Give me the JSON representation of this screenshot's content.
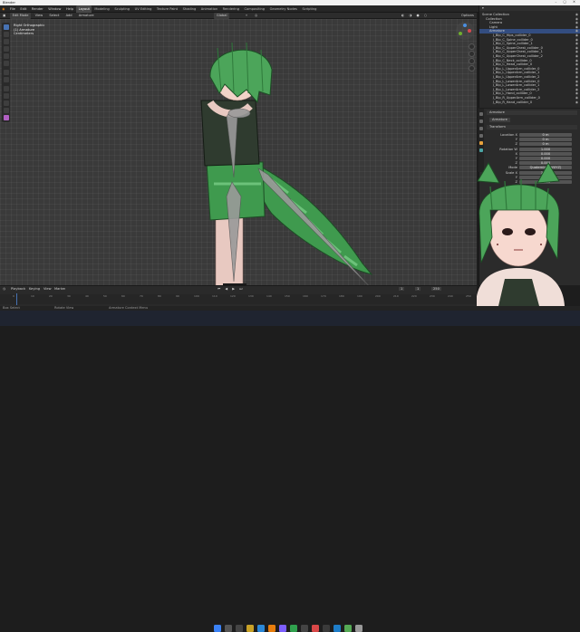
{
  "window": {
    "title": "Blender"
  },
  "menu": {
    "items": [
      "File",
      "Edit",
      "Render",
      "Window",
      "Help"
    ],
    "workspaces": [
      "Layout",
      "Modeling",
      "Sculpting",
      "UV Editing",
      "Texture Paint",
      "Shading",
      "Animation",
      "Rendering",
      "Compositing",
      "Geometry Nodes",
      "Scripting"
    ],
    "active_workspace": "Layout",
    "scene": "Scene",
    "view_layer": "ViewLayer"
  },
  "header": {
    "mode": "Edit Mode",
    "items": [
      "View",
      "Select",
      "Add",
      "Armature"
    ],
    "transform_orientation": "Global",
    "options": "Options"
  },
  "viewport": {
    "info_lines": [
      "Right Orthographic",
      "(1) Armature",
      "Centimeters"
    ],
    "overlay_label": "Options"
  },
  "outliner": {
    "title": "Scene Collection",
    "rows": [
      {
        "label": "Scene Collection",
        "indent": 0
      },
      {
        "label": "Collection",
        "indent": 1
      },
      {
        "label": "Camera",
        "indent": 2
      },
      {
        "label": "Light",
        "indent": 2
      },
      {
        "label": "Armature",
        "indent": 2
      },
      {
        "label": "J_Bip_C_Hips_collider_0",
        "indent": 3
      },
      {
        "label": "J_Bip_C_Spine_collider_0",
        "indent": 3
      },
      {
        "label": "J_Bip_C_Spine_collider_1",
        "indent": 3
      },
      {
        "label": "J_Bip_C_UpperChest_collider_0",
        "indent": 3
      },
      {
        "label": "J_Bip_C_UpperChest_collider_1",
        "indent": 3
      },
      {
        "label": "J_Bip_C_UpperChest_collider_2",
        "indent": 3
      },
      {
        "label": "J_Bip_C_Neck_collider_0",
        "indent": 3
      },
      {
        "label": "J_Bip_C_Head_collider_0",
        "indent": 3
      },
      {
        "label": "J_Bip_L_UpperArm_collider_0",
        "indent": 3
      },
      {
        "label": "J_Bip_L_UpperArm_collider_1",
        "indent": 3
      },
      {
        "label": "J_Bip_L_UpperArm_collider_2",
        "indent": 3
      },
      {
        "label": "J_Bip_L_LowerArm_collider_0",
        "indent": 3
      },
      {
        "label": "J_Bip_L_LowerArm_collider_1",
        "indent": 3
      },
      {
        "label": "J_Bip_L_LowerArm_collider_2",
        "indent": 3
      },
      {
        "label": "J_Bip_L_Hand_collider_0",
        "indent": 3
      },
      {
        "label": "J_Bip_R_UpperArm_collider_0",
        "indent": 3
      },
      {
        "label": "J_Bip_R_Hand_collider_0",
        "indent": 3
      }
    ]
  },
  "properties": {
    "object": "Armature",
    "data_name": "Armature",
    "section": "Transform",
    "fields": [
      {
        "label": "Location X",
        "value": "0 m"
      },
      {
        "label": "Y",
        "value": "0 m"
      },
      {
        "label": "Z",
        "value": "0 m"
      },
      {
        "label": "Rotation W",
        "value": "1.000"
      },
      {
        "label": "X",
        "value": "0.000"
      },
      {
        "label": "Y",
        "value": "0.000"
      },
      {
        "label": "Z",
        "value": "0.000"
      },
      {
        "label": "Mode",
        "value": "Quaternion (WXYZ)"
      },
      {
        "label": "Scale X",
        "value": "1.000"
      },
      {
        "label": "Y",
        "value": "1.000"
      },
      {
        "label": "Z",
        "value": "1.000"
      }
    ]
  },
  "timeline": {
    "menu": [
      "Playback",
      "Keying",
      "View",
      "Marker"
    ],
    "current_frame": "1",
    "start": "1",
    "end": "250",
    "ticks": [
      "0",
      "10",
      "20",
      "30",
      "40",
      "50",
      "60",
      "70",
      "80",
      "90",
      "100",
      "110",
      "120",
      "130",
      "140",
      "150",
      "160",
      "170",
      "180",
      "190",
      "200",
      "210",
      "220",
      "230",
      "240",
      "250"
    ]
  },
  "status": {
    "items": [
      "Box Select",
      "Rotate View",
      "Armature Context Menu"
    ],
    "version": "3.x"
  },
  "colors": {
    "accent": "#4772b3",
    "active_tab": "#474747",
    "hair": "#4ca55a",
    "bone": "#9a9a9a"
  }
}
